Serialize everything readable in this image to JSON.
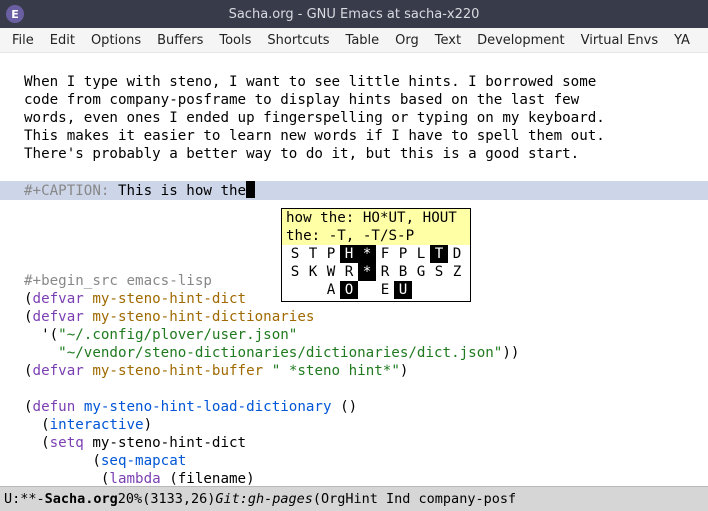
{
  "window": {
    "title": "Sacha.org - GNU Emacs at sacha-x220",
    "icon_glyph": "E"
  },
  "menubar": {
    "items": [
      "File",
      "Edit",
      "Options",
      "Buffers",
      "Tools",
      "Shortcuts",
      "Table",
      "Org",
      "Text",
      "Development",
      "Virtual Envs",
      "YA"
    ]
  },
  "buffer": {
    "paragraph": "When I type with steno, I want to see little hints. I borrowed some\ncode from company-posframe to display hints based on the last few\nwords, even ones I ended up fingerspelling or typing on my keyboard.\nThis makes it easier to learn new words if I have to spell them out.\nThere's probably a better way to do it, but this is a good start.",
    "caption_kw": "#+CAPTION:",
    "caption_text": " This is how the",
    "begin_src": "#+begin_src emacs-lisp",
    "code": {
      "defvar": "defvar",
      "defun": "defun",
      "v1": "my-steno-hint-dict",
      "v2": "my-steno-hint-dictionaries",
      "s1": "\"~/.config/plover/user.json\"",
      "s2": "\"~/vendor/steno-dictionaries/dictionaries/dict.json\"",
      "close2": "))",
      "v3": "my-steno-hint-buffer",
      "s3": "\" *steno hint*\"",
      "close1": ")",
      "fn1": "my-steno-hint-load-dictionary",
      "unit": " ()",
      "interactive": "interactive",
      "setq": "setq",
      "v4": "my-steno-hint-dict",
      "seqmapcat": "seq-mapcat",
      "lambda": "lambda",
      "lambda_arg": " (filename)"
    }
  },
  "hint": {
    "l1": "how the: HO*UT, HOUT",
    "l2": "the: -T, -T/S-P",
    "row1": [
      "S",
      "T",
      "P",
      "H",
      "*",
      "F",
      "P",
      "L",
      "T",
      "D"
    ],
    "row1_inv": [
      false,
      false,
      false,
      true,
      true,
      false,
      false,
      false,
      true,
      false
    ],
    "row2": [
      "S",
      "K",
      "W",
      "R",
      "*",
      "R",
      "B",
      "G",
      "S",
      "Z"
    ],
    "row2_inv": [
      false,
      false,
      false,
      false,
      true,
      false,
      false,
      false,
      false,
      false
    ],
    "row3": [
      "",
      "",
      "A",
      "O",
      "",
      "E",
      "U",
      "",
      "",
      ""
    ],
    "row3_inv": [
      false,
      false,
      false,
      true,
      false,
      false,
      true,
      false,
      false,
      false
    ]
  },
  "modeline": {
    "status": "U:**-",
    "gap1": "  ",
    "buffer_name": "Sacha.org",
    "gap2": "      ",
    "percent": "20%",
    "gap3": "   ",
    "pos": "(3133,26)",
    "gap4": " ",
    "git": "Git:gh-pages",
    "gap5": "  ",
    "modes": "(OrgHint Ind company-posf"
  }
}
